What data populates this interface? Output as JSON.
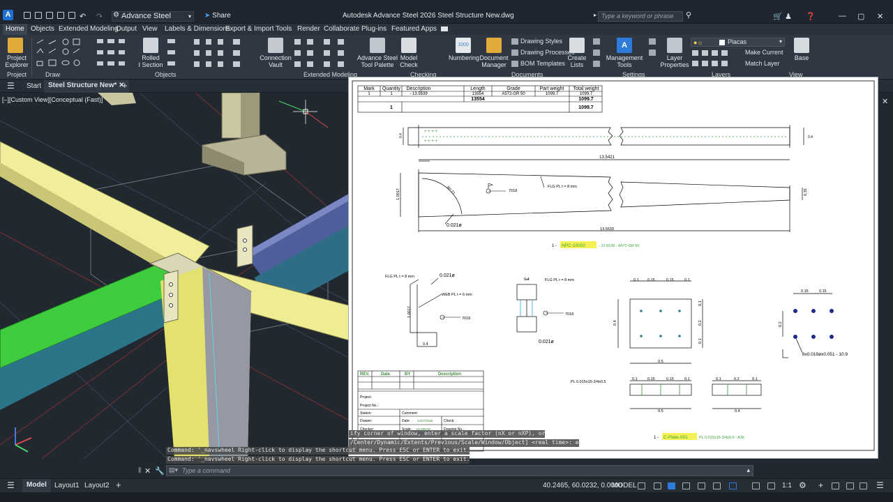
{
  "app": {
    "logo": "A",
    "workspace": "Advance Steel",
    "share": "Share",
    "title": "Autodesk Advance Steel 2026   Steel Structure New.dwg",
    "search_placeholder": "Type a keyword or phrase"
  },
  "menu": [
    "Home",
    "Objects",
    "Extended Modeling",
    "Output",
    "View",
    "Labels & Dimensions",
    "Export & Import",
    "Tools",
    "Render",
    "Collaborate",
    "Plug-ins",
    "Featured Apps"
  ],
  "ribbon": {
    "project_explorer": "Project\nExplorer",
    "rolled_section": "Rolled\nI Section",
    "connection_vault": "Connection\nVault",
    "tool_palette": "Advance Steel\nTool Palette",
    "model_check": "Model\nCheck",
    "numbering": "Numbering",
    "document_manager": "Document\nManager",
    "drawing_styles": "Drawing Styles",
    "drawing_processes": "Drawing Processes",
    "bom_templates": "BOM Templates",
    "create_lists": "Create\nLists",
    "management_tools": "Management\nTools",
    "layer_properties": "Layer\nProperties",
    "layer_name": "Placas",
    "make_current": "Make Current",
    "match_layer": "Match Layer",
    "base": "Base",
    "groups": [
      "Project",
      "Draw",
      "Objects",
      "Extended Modeling",
      "Checking",
      "Documents",
      "Settings",
      "Layers",
      "View"
    ]
  },
  "tabs": {
    "start": "Start",
    "active": "Steel Structure New*"
  },
  "viewport": {
    "label": "[–][Custom View][Conceptual (Fast)]"
  },
  "bom": {
    "headers": [
      "Mark",
      "Quantity",
      "Description",
      "Length",
      "Grade",
      "Part weight",
      "Total weight"
    ],
    "row": [
      "1",
      "1",
      "- 13.5539",
      "13554",
      "A572-GR 50",
      "1099.7",
      "1099.7"
    ],
    "subtotal_length": "13554",
    "subtotal_weight": "1099.7",
    "total_qty": "1",
    "total_weight": "1099.7"
  },
  "drawing": {
    "len1": "13.5421",
    "len2": "13.5539",
    "h1": "1.0017",
    "h_end": "0.35",
    "flg": "FLG PL t = 8 mm",
    "web": "WEB PL t = 6 mm",
    "dia": "0.021ø",
    "weld": "7018",
    "r": "R0.21",
    "t04": "0.4",
    "dim01": "0.1",
    "dim015": "0.15",
    "dim02": "0.2",
    "dim05": "0.5",
    "caption1_prefix": "1 -",
    "caption1_mark": "NPC-10002",
    "caption1_rest": "- 13.5539 - A572-GR 50",
    "caption2_prefix": "1 -",
    "caption2_mark": "C-Plate-001",
    "caption2_rest": "PL 0.015x15-3/4x0.5 - A36",
    "pl_label": "PL 0.015x15-3/4x0.5",
    "bolt_label": "6x0.019øx0.051 - 10.9"
  },
  "titleblock": {
    "rev_headers": [
      "REV.",
      "Date",
      "BY",
      "Description"
    ],
    "project": "Project:",
    "project_no": "Project No.:",
    "station": "Station:",
    "comment": "Comment:",
    "drawer": "Drawer:",
    "date": "Date:",
    "date_val": "12/07/2026",
    "checker": "Checker:",
    "checker2": "Check:",
    "scale": "Scale:",
    "scale_val": "AS-DRAW",
    "drawing_no": "Drawing No.:"
  },
  "command": {
    "line1": "Command: '_navswheel Right-click to display the shortcut menu. Press ESC or ENTER to exit.",
    "line2": "Command: '_navswheel Right-click to display the shortcut menu. Press ESC or ENTER to exit.",
    "scale_prompt1": "ify corner of window, enter a scale factor (nX or nXP), or",
    "scale_prompt2": "/Center/Dynamic/Extents/Previous/Scale/Window/Object] <real time>: e",
    "placeholder": "Type a command"
  },
  "status": {
    "model_tab": "Model",
    "layout1": "Layout1",
    "layout2": "Layout2",
    "coords": "40.2465, 60.0232, 0.0000",
    "mode": "MODEL",
    "scale": "1:1"
  }
}
